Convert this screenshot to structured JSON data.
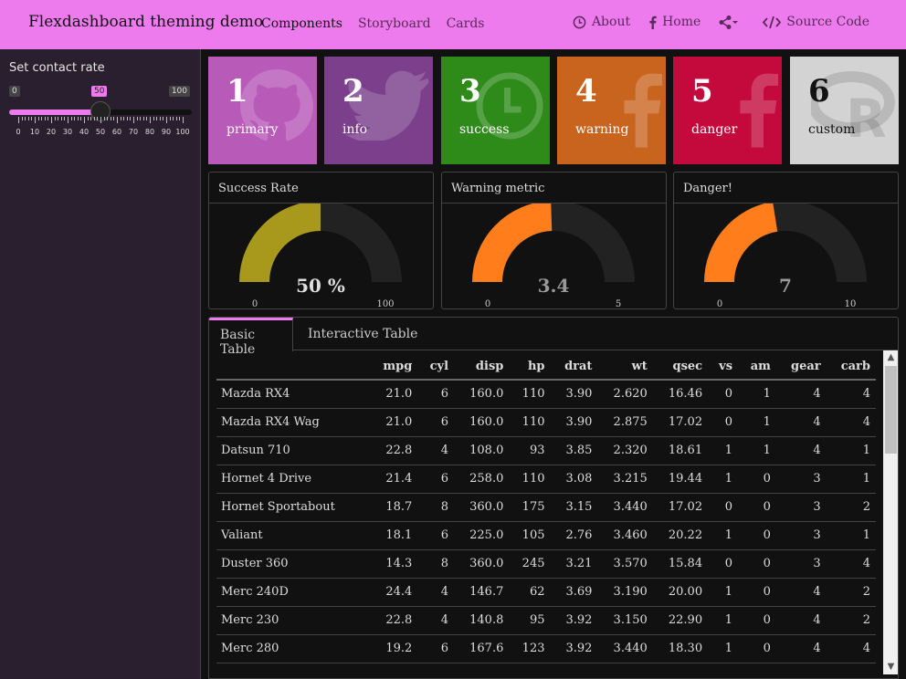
{
  "navbar": {
    "brand": "Flexdashboard theming demo",
    "left": [
      "Components",
      "Storyboard",
      "Cards"
    ],
    "about": "About",
    "home": "Home",
    "source": "Source Code",
    "color": "#ee7bee"
  },
  "sidebar": {
    "label": "Set contact rate",
    "slider": {
      "min": 0,
      "max": 100,
      "value": 50,
      "ticks": [
        "0",
        "10",
        "20",
        "30",
        "40",
        "50",
        "60",
        "70",
        "80",
        "90",
        "100"
      ]
    }
  },
  "valueboxes": [
    {
      "value": "1",
      "caption": "primary",
      "color": "#b85ab8",
      "icon": "github-icon"
    },
    {
      "value": "2",
      "caption": "info",
      "color": "#7b3f8c",
      "icon": "twitter-icon"
    },
    {
      "value": "3",
      "caption": "success",
      "color": "#2e8b1a",
      "icon": "clock-icon"
    },
    {
      "value": "4",
      "caption": "warning",
      "color": "#c8641e",
      "icon": "facebook-icon"
    },
    {
      "value": "5",
      "caption": "danger",
      "color": "#c4093c",
      "icon": "facebook-icon"
    },
    {
      "value": "6",
      "caption": "custom",
      "color": "#d3d3d3",
      "icon": "r-logo-icon"
    }
  ],
  "gauges": [
    {
      "title": "Success Rate",
      "value": 50,
      "label": "50 %",
      "min": "0",
      "max": "100",
      "fraction": 0.5,
      "color": "#a8991c"
    },
    {
      "title": "Warning metric",
      "value": 3.4,
      "label": "3.4",
      "min": "0",
      "max": "5",
      "fraction": 0.49,
      "color": "#ff7d1a"
    },
    {
      "title": "Danger!",
      "value": 7,
      "label": "7",
      "min": "0",
      "max": "10",
      "fraction": 0.45,
      "color": "#ff7d1a"
    }
  ],
  "tabs": [
    "Basic Table",
    "Interactive Table"
  ],
  "table": {
    "columns": [
      "",
      "mpg",
      "cyl",
      "disp",
      "hp",
      "drat",
      "wt",
      "qsec",
      "vs",
      "am",
      "gear",
      "carb"
    ],
    "rows": [
      [
        "Mazda RX4",
        "21.0",
        "6",
        "160.0",
        "110",
        "3.90",
        "2.620",
        "16.46",
        "0",
        "1",
        "4",
        "4"
      ],
      [
        "Mazda RX4 Wag",
        "21.0",
        "6",
        "160.0",
        "110",
        "3.90",
        "2.875",
        "17.02",
        "0",
        "1",
        "4",
        "4"
      ],
      [
        "Datsun 710",
        "22.8",
        "4",
        "108.0",
        "93",
        "3.85",
        "2.320",
        "18.61",
        "1",
        "1",
        "4",
        "1"
      ],
      [
        "Hornet 4 Drive",
        "21.4",
        "6",
        "258.0",
        "110",
        "3.08",
        "3.215",
        "19.44",
        "1",
        "0",
        "3",
        "1"
      ],
      [
        "Hornet Sportabout",
        "18.7",
        "8",
        "360.0",
        "175",
        "3.15",
        "3.440",
        "17.02",
        "0",
        "0",
        "3",
        "2"
      ],
      [
        "Valiant",
        "18.1",
        "6",
        "225.0",
        "105",
        "2.76",
        "3.460",
        "20.22",
        "1",
        "0",
        "3",
        "1"
      ],
      [
        "Duster 360",
        "14.3",
        "8",
        "360.0",
        "245",
        "3.21",
        "3.570",
        "15.84",
        "0",
        "0",
        "3",
        "4"
      ],
      [
        "Merc 240D",
        "24.4",
        "4",
        "146.7",
        "62",
        "3.69",
        "3.190",
        "20.00",
        "1",
        "0",
        "4",
        "2"
      ],
      [
        "Merc 230",
        "22.8",
        "4",
        "140.8",
        "95",
        "3.92",
        "3.150",
        "22.90",
        "1",
        "0",
        "4",
        "2"
      ],
      [
        "Merc 280",
        "19.2",
        "6",
        "167.6",
        "123",
        "3.92",
        "3.440",
        "18.30",
        "1",
        "0",
        "4",
        "4"
      ]
    ]
  }
}
